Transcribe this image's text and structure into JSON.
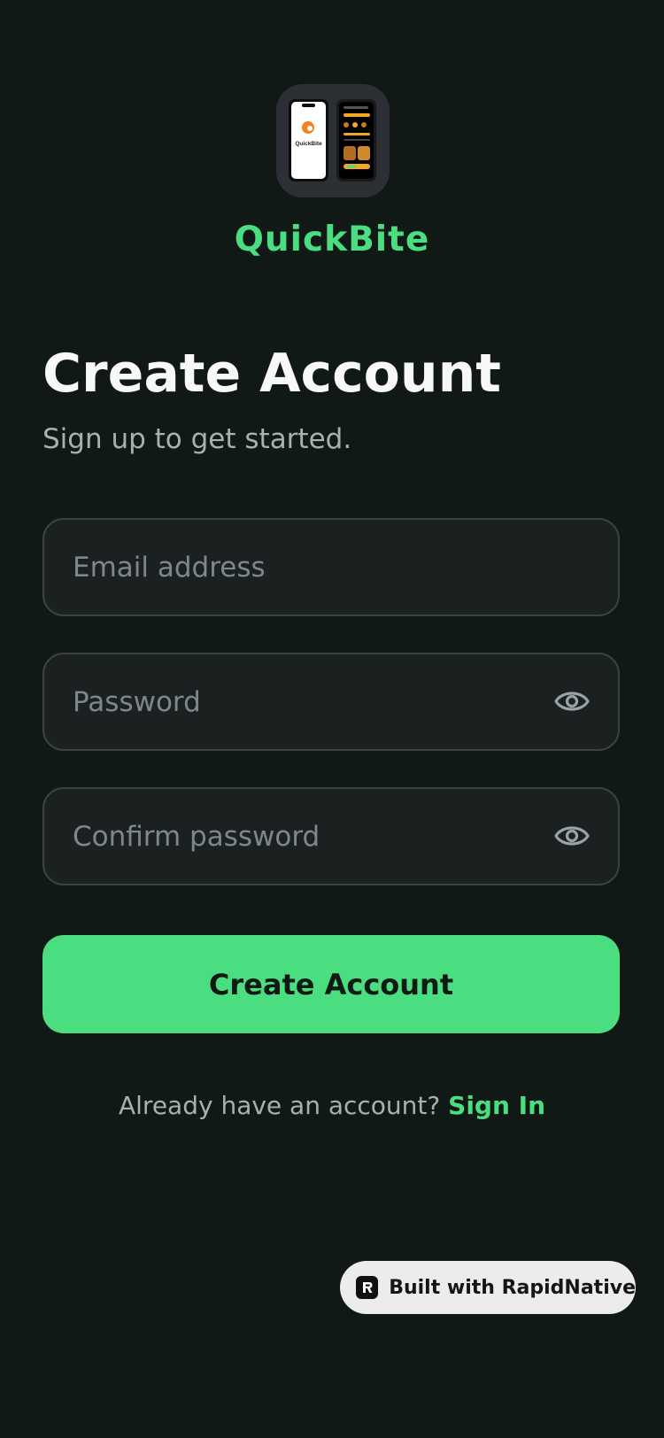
{
  "app": {
    "name": "QuickBite",
    "accent_color": "#4ade80",
    "background_color": "#111916",
    "logo_icon": "app-screens-icon",
    "logo_inner_text": "QuickBite"
  },
  "header": {
    "title": "Create Account",
    "subtitle": "Sign up to get started."
  },
  "form": {
    "email": {
      "placeholder": "Email address",
      "value": ""
    },
    "password": {
      "placeholder": "Password",
      "value": "",
      "toggle_icon": "eye-icon"
    },
    "confirm_password": {
      "placeholder": "Confirm password",
      "value": "",
      "toggle_icon": "eye-icon"
    },
    "submit_label": "Create Account"
  },
  "footer": {
    "prompt": "Already have an account?",
    "link_label": "Sign In"
  },
  "badge": {
    "label": "Built with RapidNative",
    "icon": "rapidnative-logo-icon"
  }
}
